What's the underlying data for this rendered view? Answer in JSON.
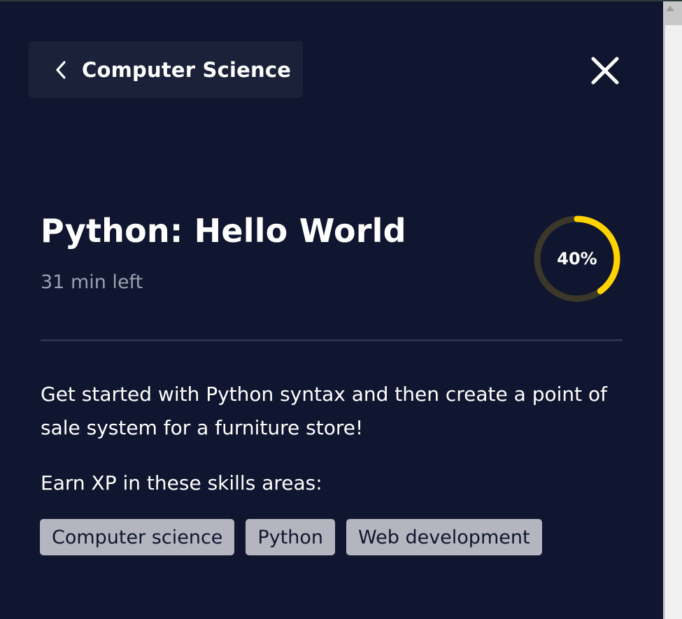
{
  "header": {
    "back_label": "Computer Science",
    "back_icon": "chevron-left-icon",
    "close_icon": "close-icon"
  },
  "course": {
    "title": "Python: Hello World",
    "time_left": "31 min left",
    "progress_label": "40%",
    "progress_fraction": 0.4,
    "progress_color": "#ffd300",
    "progress_track_color": "#3b382a"
  },
  "description": "Get started with Python syntax and then create a point of sale system for a furniture store!",
  "skills": {
    "heading": "Earn XP in these skills areas:",
    "tags": [
      "Computer science",
      "Python",
      "Web development"
    ]
  }
}
